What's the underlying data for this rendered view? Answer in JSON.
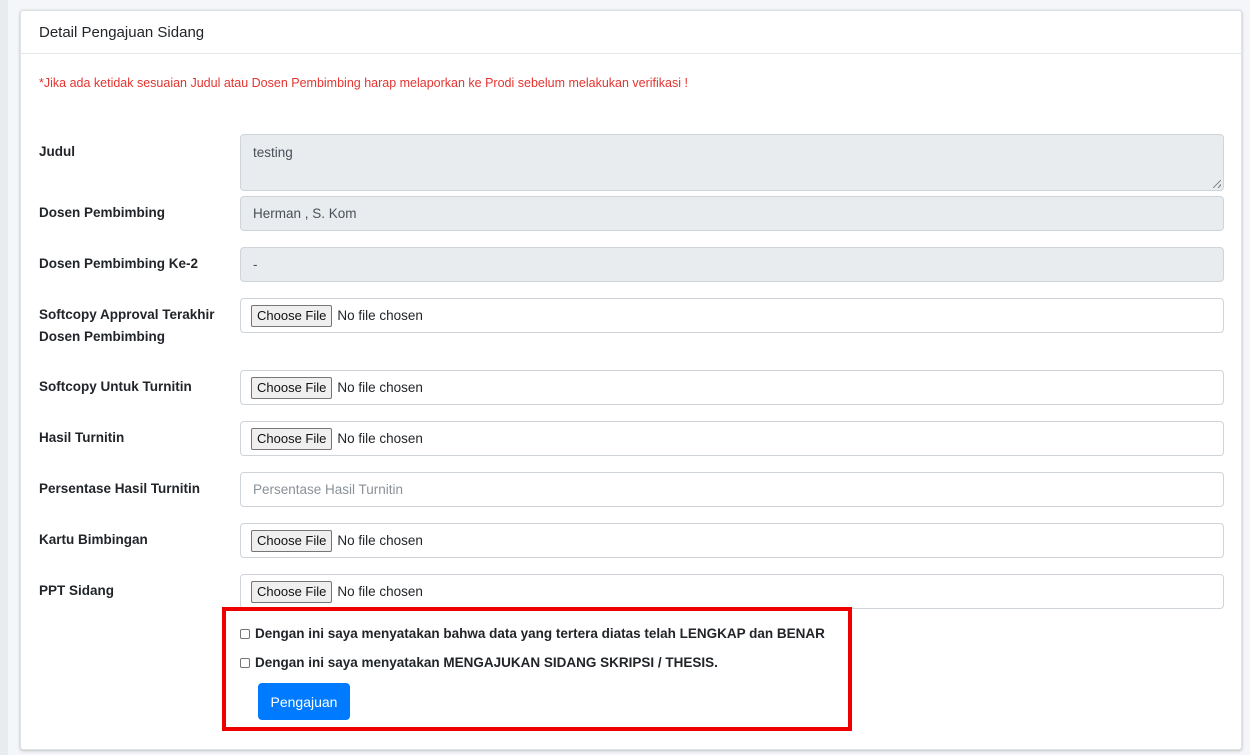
{
  "card": {
    "title": "Detail Pengajuan Sidang",
    "note": "*Jika ada ketidak sesuaian Judul atau Dosen Pembimbing harap melaporkan ke Prodi sebelum melakukan verifikasi !"
  },
  "form": {
    "judul": {
      "label": "Judul",
      "value": "testing"
    },
    "dosen_pembimbing": {
      "label": "Dosen Pembimbing",
      "value": "Herman , S. Kom"
    },
    "dosen_pembimbing_2": {
      "label": "Dosen Pembimbing Ke-2",
      "value": "-"
    },
    "softcopy_approval": {
      "label_line1": "Softcopy Approval Terakhir",
      "label_line2": "Dosen Pembimbing",
      "button": "Choose File",
      "status": "No file chosen"
    },
    "softcopy_turnitin": {
      "label": "Softcopy Untuk Turnitin",
      "button": "Choose File",
      "status": "No file chosen"
    },
    "hasil_turnitin": {
      "label": "Hasil Turnitin",
      "button": "Choose File",
      "status": "No file chosen"
    },
    "persentase": {
      "label": "Persentase Hasil Turnitin",
      "placeholder": "Persentase Hasil Turnitin",
      "value": ""
    },
    "kartu_bimbingan": {
      "label": "Kartu Bimbingan",
      "button": "Choose File",
      "status": "No file chosen"
    },
    "ppt_sidang": {
      "label": "PPT Sidang",
      "button": "Choose File",
      "status": "No file chosen"
    }
  },
  "confirm": {
    "check1": "Dengan ini saya menyatakan bahwa data yang tertera diatas telah LENGKAP dan BENAR",
    "check2": "Dengan ini saya menyatakan MENGAJUKAN SIDANG SKRIPSI / THESIS.",
    "submit": "Pengajuan"
  },
  "colors": {
    "note": "#e3342f",
    "primary": "#007bff",
    "highlight_border": "#ee0000",
    "readonly_bg": "#e9ecef"
  }
}
